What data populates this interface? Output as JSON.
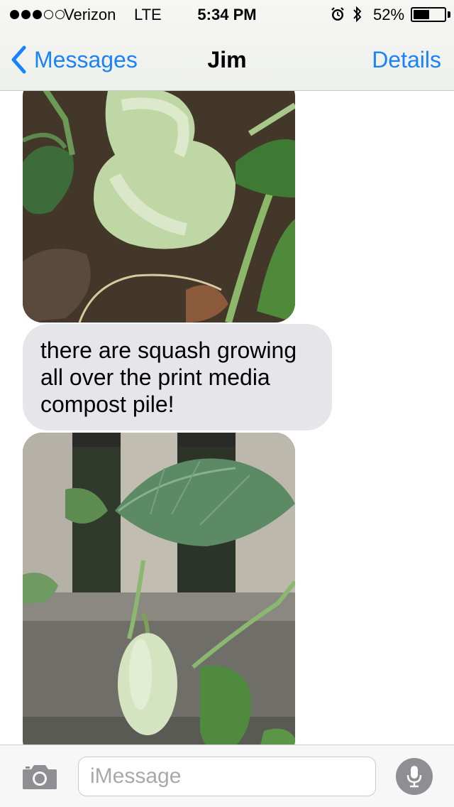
{
  "status_bar": {
    "signal_dots_filled": 3,
    "signal_dots_total": 5,
    "carrier": "Verizon",
    "network": "LTE",
    "time": "5:34 PM",
    "alarm_icon": "alarm-icon",
    "bluetooth_icon": "bluetooth-icon",
    "battery_percent_label": "52%",
    "battery_level": 0.52
  },
  "nav": {
    "back_label": "Messages",
    "title": "Jim",
    "details_label": "Details"
  },
  "messages": [
    {
      "type": "image",
      "subject": "butternut squash on compost pile"
    },
    {
      "type": "text",
      "lines": [
        "there are squash growing",
        "all over the print media",
        "compost pile!"
      ]
    },
    {
      "type": "image",
      "subject": "squash vine by concrete fence"
    }
  ],
  "input_bar": {
    "camera_icon": "camera-icon",
    "placeholder": "iMessage",
    "mic_icon": "microphone-icon"
  },
  "colors": {
    "accent": "#1a82fb",
    "received_bubble": "#e5e5ea"
  }
}
